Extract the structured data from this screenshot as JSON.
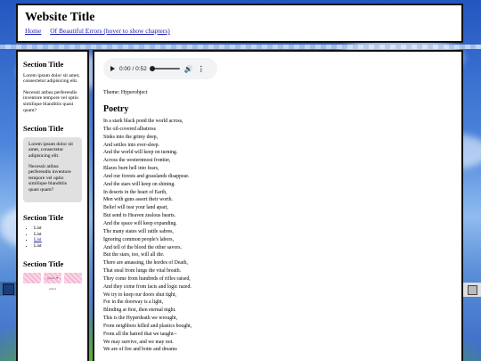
{
  "header": {
    "site_title": "Website Title",
    "nav": [
      "Home",
      "Of Beautiful Errors (hover to show chapters)"
    ]
  },
  "sidebar": {
    "section1": {
      "title": "Section Title",
      "p1": "Lorem ipsum dolor sit amet, consectetur adipisicing elit.",
      "p2": "Necessit atibus perferendis inventore tempore vel optio similique blanditiis quasi quam?"
    },
    "section2": {
      "title": "Section Title",
      "p1": "Lorem ipsum dolor sit amet, consectetur adipisicing elit.",
      "p2": "Necessit atibus perferendis inventore tempore vel optio similique blanditiis quasi quam?"
    },
    "section3": {
      "title": "Section Title",
      "items": [
        "List",
        "List",
        "List",
        "List"
      ]
    },
    "section4": {
      "title": "Section Title",
      "badges": [
        "",
        "gencro ♥ pblod",
        ""
      ]
    }
  },
  "audio": {
    "time": "0:00 / 0:52",
    "icons": [
      "play-icon",
      "volume-icon",
      "more-icon"
    ]
  },
  "theme": "Theme: Hyperobject",
  "poem": {
    "title": "Poetry",
    "lines": [
      "In a stark black pond the world across,",
      "The oil-covered albatross",
      "Sinks into the grimy deep,",
      "And settles into ever-sleep.",
      "And the world will keep on turning.",
      "Across the westernmost frontier,",
      "Blazes burn hell into fears,",
      "And our forests and grasslands disappear.",
      "And the stars will keep on shining.",
      "In deserts in the heart of Earth,",
      "Men with guns assert their worth.",
      "Belief will tear your land apart,",
      "But send to Heaven zealous hearts.",
      "And the space will keep expanding.",
      "The many states will rattle sabres,",
      "Ignoring common people's labors,",
      "And tell of the blood the other savors.",
      "But the stars, too, will all die.",
      "There are amassing, the hordes of Death,",
      "That steal from lungs the vital breath.",
      "They come from hundreds of rifles raised,",
      "And they come from facts and logic razed.",
      "We try to keep our doors shut tight,",
      "For in the doorway is a light,",
      "Blinding at first, then eternal night.",
      "This is the Hyperdeath we wrought,",
      "From neighbors killed and plastics bought,",
      "From all the hatred that we taught--",
      "We may survive, and we may not.",
      "We are of fire and botte and dreams"
    ]
  }
}
